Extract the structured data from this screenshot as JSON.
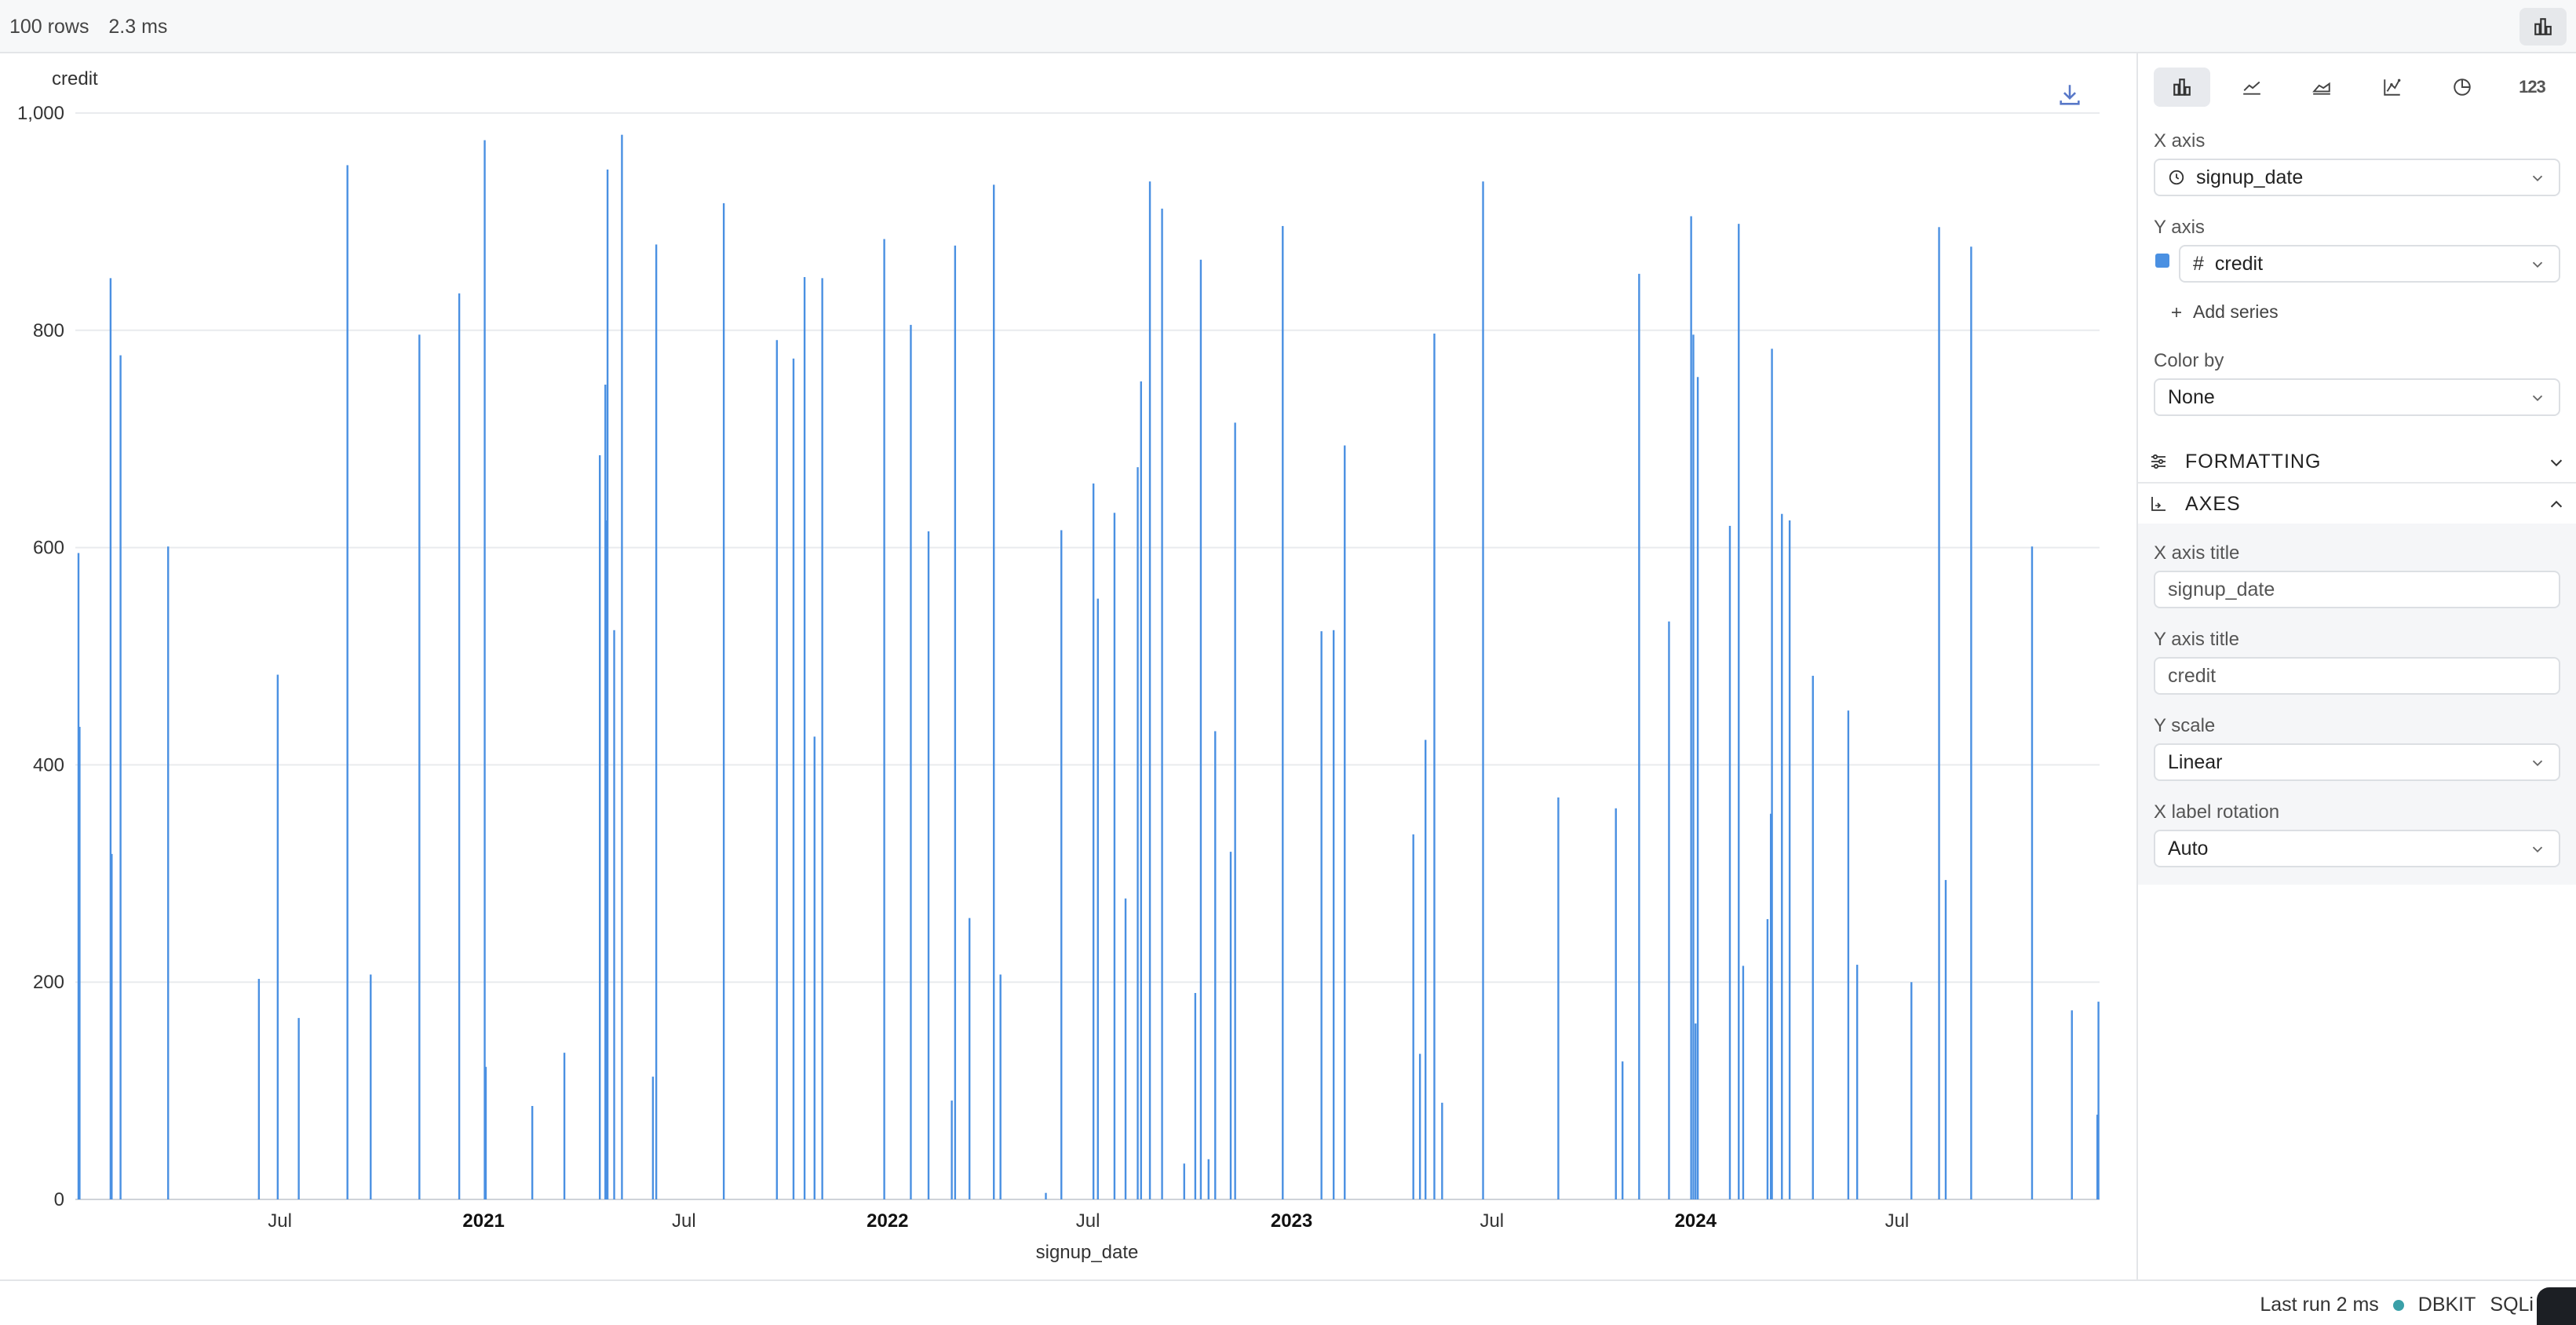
{
  "topbar": {
    "rows": "100 rows",
    "time": "2.3 ms",
    "chart_toggle_icon": "bar-chart-icon"
  },
  "chart_data": {
    "type": "bar",
    "title": "",
    "xlabel": "signup_date",
    "ylabel": "credit",
    "ylim": [
      0,
      1000
    ],
    "yticks": [
      0,
      200,
      400,
      600,
      800,
      1000
    ],
    "ytick_labels": [
      "0",
      "200",
      "400",
      "600",
      "800",
      "1,000"
    ],
    "xlim": [
      "2020-01-01",
      "2024-12-31"
    ],
    "xticks": [
      {
        "date": "2020-07-01",
        "label": "Jul",
        "bold": false
      },
      {
        "date": "2021-01-01",
        "label": "2021",
        "bold": true
      },
      {
        "date": "2021-07-01",
        "label": "Jul",
        "bold": false
      },
      {
        "date": "2022-01-01",
        "label": "2022",
        "bold": true
      },
      {
        "date": "2022-07-01",
        "label": "Jul",
        "bold": false
      },
      {
        "date": "2023-01-01",
        "label": "2023",
        "bold": true
      },
      {
        "date": "2023-07-01",
        "label": "Jul",
        "bold": false
      },
      {
        "date": "2024-01-01",
        "label": "2024",
        "bold": true
      },
      {
        "date": "2024-07-01",
        "label": "Jul",
        "bold": false
      }
    ],
    "grid": true,
    "bar_color": "#4a90e2",
    "x": [
      "2020-01-01",
      "2020-01-02",
      "2020-01-30",
      "2020-01-31",
      "2020-02-08",
      "2020-03-22",
      "2020-06-12",
      "2020-06-29",
      "2020-07-18",
      "2020-08-31",
      "2020-09-21",
      "2020-11-04",
      "2020-12-10",
      "2021-01-02",
      "2021-01-03",
      "2021-02-14",
      "2021-03-15",
      "2021-04-16",
      "2021-04-21",
      "2021-04-22",
      "2021-04-23",
      "2021-04-29",
      "2021-05-06",
      "2021-06-03",
      "2021-06-06",
      "2021-08-06",
      "2021-09-23",
      "2021-10-08",
      "2021-10-18",
      "2021-10-27",
      "2021-11-03",
      "2021-12-29",
      "2022-01-22",
      "2022-02-07",
      "2022-02-28",
      "2022-03-03",
      "2022-03-16",
      "2022-04-07",
      "2022-04-13",
      "2022-05-24",
      "2022-06-07",
      "2022-07-06",
      "2022-07-10",
      "2022-07-25",
      "2022-08-04",
      "2022-08-15",
      "2022-08-18",
      "2022-08-26",
      "2022-09-06",
      "2022-09-26",
      "2022-10-06",
      "2022-10-11",
      "2022-10-18",
      "2022-10-24",
      "2022-11-07",
      "2022-11-11",
      "2022-12-24",
      "2023-01-28",
      "2023-02-08",
      "2023-02-18",
      "2023-04-21",
      "2023-04-27",
      "2023-05-02",
      "2023-05-10",
      "2023-05-17",
      "2023-06-23",
      "2023-08-30",
      "2023-10-21",
      "2023-10-27",
      "2023-11-11",
      "2023-12-08",
      "2023-12-28",
      "2023-12-30",
      "2024-01-01",
      "2024-01-03",
      "2024-02-01",
      "2024-02-09",
      "2024-02-13",
      "2024-03-06",
      "2024-03-09",
      "2024-03-10",
      "2024-03-19",
      "2024-03-26",
      "2024-04-16",
      "2024-05-18",
      "2024-05-26",
      "2024-07-14",
      "2024-08-08",
      "2024-08-14",
      "2024-09-06",
      "2024-10-31",
      "2024-12-06",
      "2024-12-29",
      "2024-12-30"
    ],
    "values": [
      595,
      435,
      848,
      318,
      777,
      601,
      203,
      483,
      167,
      952,
      207,
      796,
      834,
      975,
      122,
      86,
      135,
      685,
      750,
      625,
      948,
      524,
      980,
      113,
      879,
      917,
      791,
      774,
      849,
      426,
      848,
      884,
      805,
      615,
      91,
      878,
      259,
      934,
      207,
      6,
      616,
      659,
      553,
      632,
      277,
      674,
      753,
      937,
      912,
      33,
      190,
      865,
      37,
      431,
      320,
      715,
      896,
      523,
      524,
      694,
      336,
      134,
      423,
      797,
      89,
      937,
      370,
      360,
      127,
      852,
      532,
      905,
      796,
      162,
      757,
      620,
      898,
      215,
      258,
      355,
      783,
      631,
      625,
      482,
      450,
      216,
      200,
      895,
      294,
      877,
      601,
      174,
      78,
      182,
      173,
      20,
      216
    ]
  },
  "chart": {
    "y_title": "credit",
    "x_title": "signup_date",
    "download_icon": "download-icon"
  },
  "panel": {
    "chart_types": [
      {
        "name": "bar-chart-icon",
        "active": true
      },
      {
        "name": "line-chart-icon",
        "active": false
      },
      {
        "name": "area-chart-icon",
        "active": false
      },
      {
        "name": "scatter-chart-icon",
        "active": false
      },
      {
        "name": "pie-chart-icon",
        "active": false
      },
      {
        "name": "number-icon",
        "label": "123",
        "active": false
      }
    ],
    "x_axis_label": "X axis",
    "x_axis_value": "signup_date",
    "y_axis_label": "Y axis",
    "y_axis_value": "credit",
    "y_axis_prefix": "#",
    "series_color": "#4a90e2",
    "add_series": "Add series",
    "color_by_label": "Color by",
    "color_by_value": "None",
    "formatting": "FORMATTING",
    "axes": "AXES",
    "x_axis_title_label": "X axis title",
    "x_axis_title_value": "signup_date",
    "y_axis_title_label": "Y axis title",
    "y_axis_title_value": "credit",
    "y_scale_label": "Y scale",
    "y_scale_value": "Linear",
    "x_label_rotation_label": "X label rotation",
    "x_label_rotation_value": "Auto"
  },
  "status": {
    "last_run": "Last run 2 ms",
    "dot_color": "#3aa0a8",
    "source": "DBKIT",
    "lang": "SQLi"
  }
}
